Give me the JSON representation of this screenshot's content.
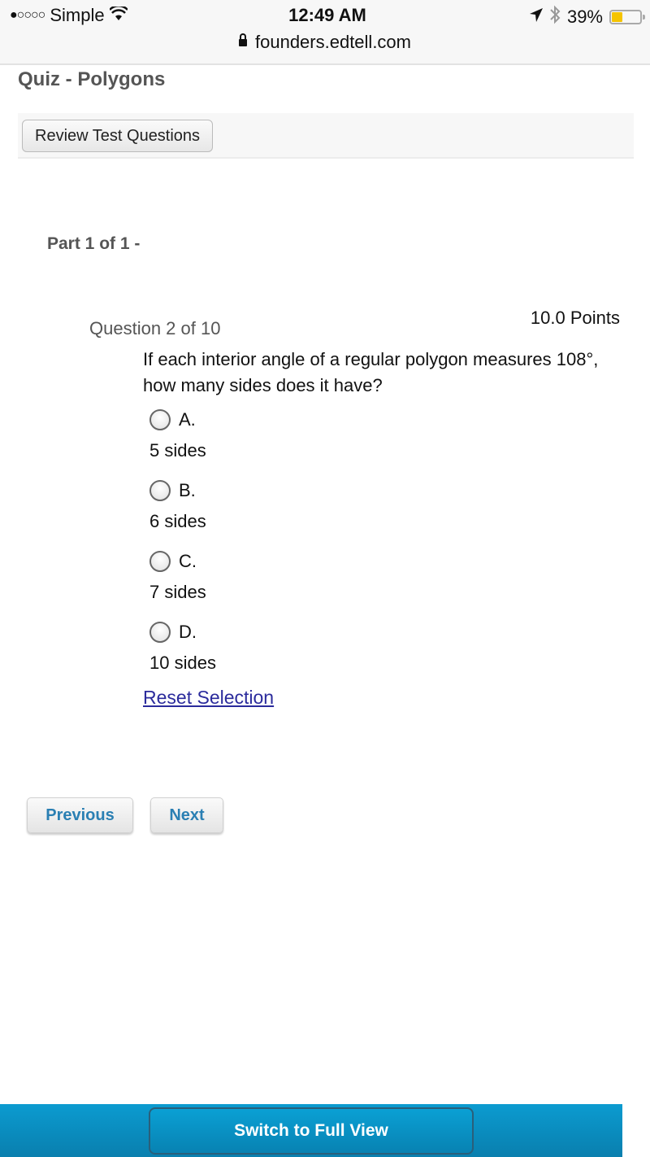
{
  "status_bar": {
    "signal": "●○○○○",
    "carrier": "Simple",
    "time": "12:49 AM",
    "battery": "39%",
    "battery_level": 0.39,
    "url": "founders.edtell.com"
  },
  "quiz": {
    "title": "Quiz - Polygons",
    "review_button": "Review Test Questions",
    "part": "Part 1 of 1 -",
    "points": "10.0 Points",
    "question_number": "Question 2 of 10",
    "question_text": "If each interior angle of a regular polygon measures 108°, how many sides does it have?",
    "options": [
      {
        "letter": "A.",
        "text": "5 sides"
      },
      {
        "letter": "B.",
        "text": "6 sides"
      },
      {
        "letter": "C.",
        "text": "7 sides"
      },
      {
        "letter": "D.",
        "text": "10 sides"
      }
    ],
    "reset_link": "Reset Selection",
    "previous_button": "Previous",
    "next_button": "Next"
  },
  "footer": {
    "full_view_button": "Switch to Full View"
  }
}
